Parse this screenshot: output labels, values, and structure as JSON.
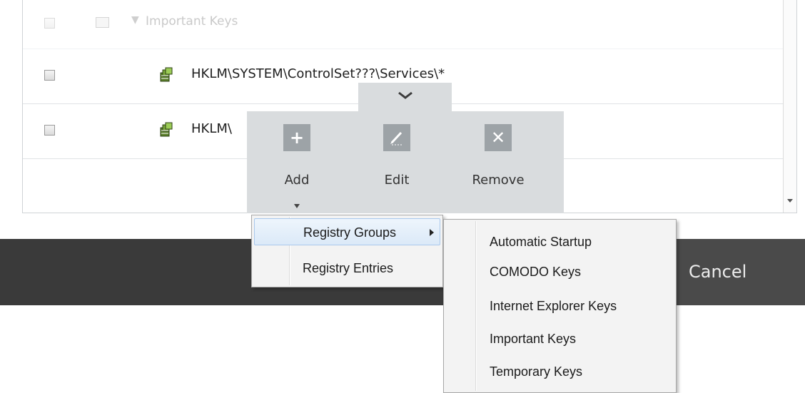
{
  "list": {
    "group_label": "Important Keys",
    "entries": [
      "HKLM\\SYSTEM\\ControlSet???\\Services\\*",
      "HKLM\\"
    ]
  },
  "actions": {
    "add_label": "Add",
    "edit_label": "Edit",
    "remove_label": "Remove",
    "add_icon": "+",
    "remove_icon": "✕"
  },
  "add_menu": {
    "items": [
      "Registry Groups",
      "Registry Entries"
    ]
  },
  "groups_submenu": {
    "items": [
      "Automatic Startup",
      "COMODO Keys",
      "Internet Explorer Keys",
      "Important Keys",
      "Temporary Keys"
    ]
  },
  "footer": {
    "cancel_label": "Cancel"
  },
  "colors": {
    "popup_bg": "#d9dcde",
    "action_icon_bg": "#9da3a7",
    "dark_bar": "#3a3a3a",
    "menu_highlight": "#dbe9f8"
  }
}
